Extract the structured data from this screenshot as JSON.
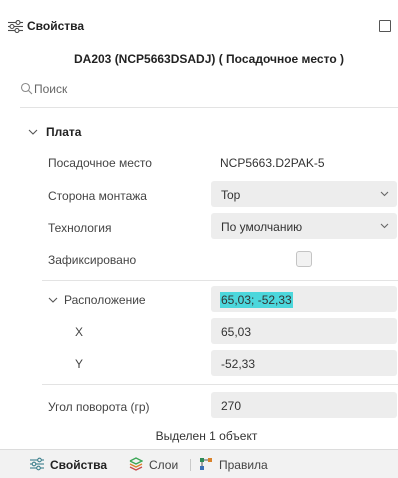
{
  "header": {
    "title": "Свойства",
    "icon": "properties-sliders-icon"
  },
  "component_title": "DA203 (NCP5663DSADJ) ( Посадочное место )",
  "search": {
    "placeholder": "Поиск",
    "value": ""
  },
  "group": {
    "label": "Плата",
    "expanded": true,
    "properties": {
      "footprint": {
        "label": "Посадочное место",
        "value": "NCP5663.D2PAK-5"
      },
      "mount_side": {
        "label": "Сторона монтажа",
        "value": "Top"
      },
      "technology": {
        "label": "Технология",
        "value": "По умолчанию"
      },
      "locked": {
        "label": "Зафиксировано",
        "checked": false
      },
      "location": {
        "label": "Расположение",
        "value": "65,03; -52,33",
        "expanded": true,
        "x": {
          "label": "X",
          "value": "65,03"
        },
        "y": {
          "label": "Y",
          "value": "-52,33"
        }
      },
      "rotation": {
        "label": "Угол поворота (гр)",
        "value": "270"
      }
    }
  },
  "status": "Выделен 1 объект",
  "tabs": [
    {
      "label": "Свойства",
      "icon": "properties-sliders-icon",
      "active": true
    },
    {
      "label": "Слои",
      "icon": "layers-icon",
      "active": false
    },
    {
      "label": "Правила",
      "icon": "rules-icon",
      "active": false
    }
  ],
  "colors": {
    "highlight": "#4cd7dc",
    "field_bg": "#ededed",
    "tabbar_bg": "#f2f2f2"
  }
}
